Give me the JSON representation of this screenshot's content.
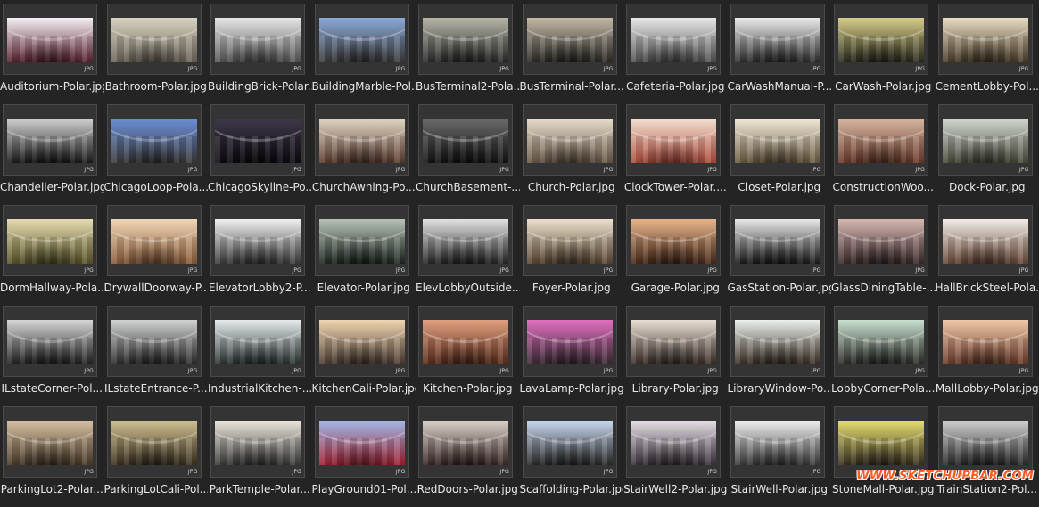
{
  "files": [
    {
      "label": "Auditorium-Polar.jpg",
      "badge": "JPG",
      "c1": "#f4f0f4",
      "c2": "#5a2030"
    },
    {
      "label": "Bathroom-Polar.jpg",
      "badge": "JPG",
      "c1": "#d8d2c2",
      "c2": "#6b6457"
    },
    {
      "label": "BuildingBrick-Polar...",
      "badge": "JPG",
      "c1": "#e6e6e6",
      "c2": "#555"
    },
    {
      "label": "BuildingMarble-Pol...",
      "badge": "JPG",
      "c1": "#8aa8d8",
      "c2": "#3a3a3a"
    },
    {
      "label": "BusTerminal2-Pola...",
      "badge": "JPG",
      "c1": "#b6b6a8",
      "c2": "#2a2a2a"
    },
    {
      "label": "BusTerminal-Polar...",
      "badge": "JPG",
      "c1": "#c2b9a6",
      "c2": "#2c2a26"
    },
    {
      "label": "Cafeteria-Polar.jpg",
      "badge": "JPG",
      "c1": "#e8e8e8",
      "c2": "#505050"
    },
    {
      "label": "CarWashManual-P...",
      "badge": "JPG",
      "c1": "#ececec",
      "c2": "#2e2e2e"
    },
    {
      "label": "CarWash-Polar.jpg",
      "badge": "JPG",
      "c1": "#d6cc88",
      "c2": "#2a2a1c"
    },
    {
      "label": "CementLobby-Pol...",
      "badge": "JPG",
      "c1": "#e8dcc2",
      "c2": "#4a3b28"
    },
    {
      "label": "Chandelier-Polar.jpg",
      "badge": "JPG",
      "c1": "#cfcfcf",
      "c2": "#1b1b1b"
    },
    {
      "label": "ChicagoLoop-Pola...",
      "badge": "JPG",
      "c1": "#6b8ed8",
      "c2": "#3a3a3a"
    },
    {
      "label": "ChicagoSkyline-Po...",
      "badge": "JPG",
      "c1": "#40384a",
      "c2": "#0d0a10"
    },
    {
      "label": "ChurchAwning-Po...",
      "badge": "JPG",
      "c1": "#e0d6c4",
      "c2": "#5a3b2e"
    },
    {
      "label": "ChurchBasement-...",
      "badge": "JPG",
      "c1": "#6a6a6a",
      "c2": "#141414"
    },
    {
      "label": "Church-Polar.jpg",
      "badge": "JPG",
      "c1": "#e6dccc",
      "c2": "#6a5848"
    },
    {
      "label": "ClockTower-Polar....",
      "badge": "JPG",
      "c1": "#f2e0d0",
      "c2": "#b04a3a"
    },
    {
      "label": "Closet-Polar.jpg",
      "badge": "JPG",
      "c1": "#f0e8d8",
      "c2": "#6a5a40"
    },
    {
      "label": "ConstructionWoo...",
      "badge": "JPG",
      "c1": "#d6b6a0",
      "c2": "#6a3a2a"
    },
    {
      "label": "Dock-Polar.jpg",
      "badge": "JPG",
      "c1": "#d2d6d0",
      "c2": "#4a4a3a"
    },
    {
      "label": "DormHallway-Pola...",
      "badge": "JPG",
      "c1": "#e4dcb0",
      "c2": "#5a5428"
    },
    {
      "label": "DrywallDoorway-P...",
      "badge": "JPG",
      "c1": "#f0d6b6",
      "c2": "#8a5a38"
    },
    {
      "label": "ElevatorLobby2-P...",
      "badge": "JPG",
      "c1": "#f0f0f0",
      "c2": "#3a3a3a"
    },
    {
      "label": "Elevator-Polar.jpg",
      "badge": "JPG",
      "c1": "#b6c2b6",
      "c2": "#1e2620"
    },
    {
      "label": "ElevLobbyOutside...",
      "badge": "JPG",
      "c1": "#e2e2e2",
      "c2": "#262626"
    },
    {
      "label": "Foyer-Polar.jpg",
      "badge": "JPG",
      "c1": "#ece0cc",
      "c2": "#5a4632"
    },
    {
      "label": "Garage-Polar.jpg",
      "badge": "JPG",
      "c1": "#e6b48a",
      "c2": "#4a2a1a"
    },
    {
      "label": "GasStation-Polar.jpg",
      "badge": "JPG",
      "c1": "#e8e8e8",
      "c2": "#1a1a1a"
    },
    {
      "label": "GlassDiningTable-...",
      "badge": "JPG",
      "c1": "#d6b6b0",
      "c2": "#3a2a2a"
    },
    {
      "label": "HallBrickSteel-Pola...",
      "badge": "JPG",
      "c1": "#f0ece6",
      "c2": "#6a4838"
    },
    {
      "label": "ILstateCorner-Pol...",
      "badge": "JPG",
      "c1": "#d6d6d6",
      "c2": "#202020"
    },
    {
      "label": "ILstateEntrance-P...",
      "badge": "JPG",
      "c1": "#cfd2d0",
      "c2": "#2a2a2a"
    },
    {
      "label": "IndustrialKitchen-...",
      "badge": "JPG",
      "c1": "#e6ecec",
      "c2": "#2a3232"
    },
    {
      "label": "KitchenCali-Polar.jpg",
      "badge": "JPG",
      "c1": "#f0d6b0",
      "c2": "#4a3a30"
    },
    {
      "label": "Kitchen-Polar.jpg",
      "badge": "JPG",
      "c1": "#e0a080",
      "c2": "#5a2a1a"
    },
    {
      "label": "LavaLamp-Polar.jpg",
      "badge": "JPG",
      "c1": "#e070c0",
      "c2": "#3a2a34"
    },
    {
      "label": "Library-Polar.jpg",
      "badge": "JPG",
      "c1": "#e8ded2",
      "c2": "#3a2e28"
    },
    {
      "label": "LibraryWindow-Po...",
      "badge": "JPG",
      "c1": "#ecf0ec",
      "c2": "#3a2e24"
    },
    {
      "label": "LobbyCorner-Pola...",
      "badge": "JPG",
      "c1": "#c8e0d0",
      "c2": "#2a2a26"
    },
    {
      "label": "MallLobby-Polar.jpg",
      "badge": "JPG",
      "c1": "#f0c8a8",
      "c2": "#6a3a28"
    },
    {
      "label": "ParkingLot2-Polar...",
      "badge": "JPG",
      "c1": "#d6c0a0",
      "c2": "#4a3a2a"
    },
    {
      "label": "ParkingLotCali-Pol...",
      "badge": "JPG",
      "c1": "#d0c090",
      "c2": "#3a3020"
    },
    {
      "label": "ParkTemple-Polar...",
      "badge": "JPG",
      "c1": "#ece6dc",
      "c2": "#3a3a3a"
    },
    {
      "label": "PlayGround01-Pol...",
      "badge": "JPG",
      "c1": "#a0b8e6",
      "c2": "#a02030"
    },
    {
      "label": "RedDoors-Polar.jpg",
      "badge": "JPG",
      "c1": "#d8d2c8",
      "c2": "#3a2624"
    },
    {
      "label": "Scaffolding-Polar.jpg",
      "badge": "JPG",
      "c1": "#c8d8f0",
      "c2": "#2a2a2a"
    },
    {
      "label": "StairWell2-Polar.jpg",
      "badge": "JPG",
      "c1": "#e6e0e6",
      "c2": "#3a303a"
    },
    {
      "label": "StairWell-Polar.jpg",
      "badge": "JPG",
      "c1": "#f0f0f0",
      "c2": "#3a3a3a"
    },
    {
      "label": "StoneMall-Polar.jpg",
      "badge": "JPG",
      "c1": "#e6de70",
      "c2": "#3a3020"
    },
    {
      "label": "TrainStation2-Pol...",
      "badge": "JPG",
      "c1": "#cfcfcf",
      "c2": "#2a2a2a"
    }
  ],
  "watermark": "WWW.SKETCHUPBAR.COM"
}
